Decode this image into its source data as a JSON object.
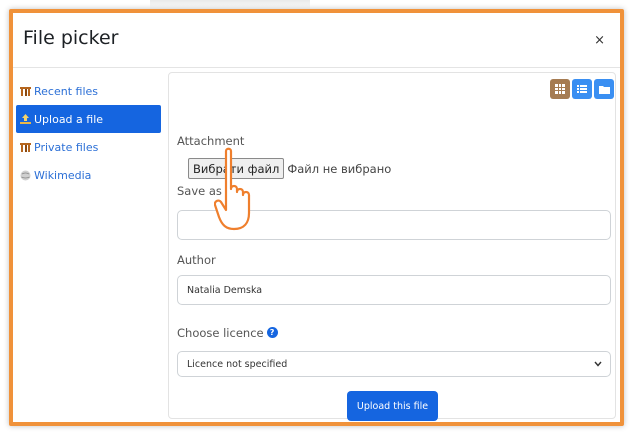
{
  "dialog": {
    "title": "File picker",
    "close_label": "×"
  },
  "sidebar": {
    "items": [
      {
        "label": "Recent files",
        "icon": "recent-files-icon",
        "active": false
      },
      {
        "label": "Upload a file",
        "icon": "upload-icon",
        "active": true
      },
      {
        "label": "Private files",
        "icon": "private-files-icon",
        "active": false
      },
      {
        "label": "Wikimedia",
        "icon": "wikimedia-icon",
        "active": false
      }
    ]
  },
  "view_buttons": [
    {
      "icon": "grid-view-icon",
      "color": "#a67c52"
    },
    {
      "icon": "list-view-icon",
      "color": "#3a8ff2"
    },
    {
      "icon": "folder-view-icon",
      "color": "#3a8ff2"
    }
  ],
  "form": {
    "attachment_label": "Attachment",
    "choose_file_label": "Вибрати файл",
    "file_status": "Файл не вибрано",
    "save_as_label": "Save as",
    "save_as_value": "",
    "author_label": "Author",
    "author_value": "Natalia Demska",
    "licence_label": "Choose licence",
    "licence_help_icon": "?",
    "licence_value": "Licence not specified",
    "upload_button": "Upload this file"
  },
  "colors": {
    "accent_border": "#f0923a",
    "primary": "#1565e0",
    "link": "#2b6fd6"
  }
}
